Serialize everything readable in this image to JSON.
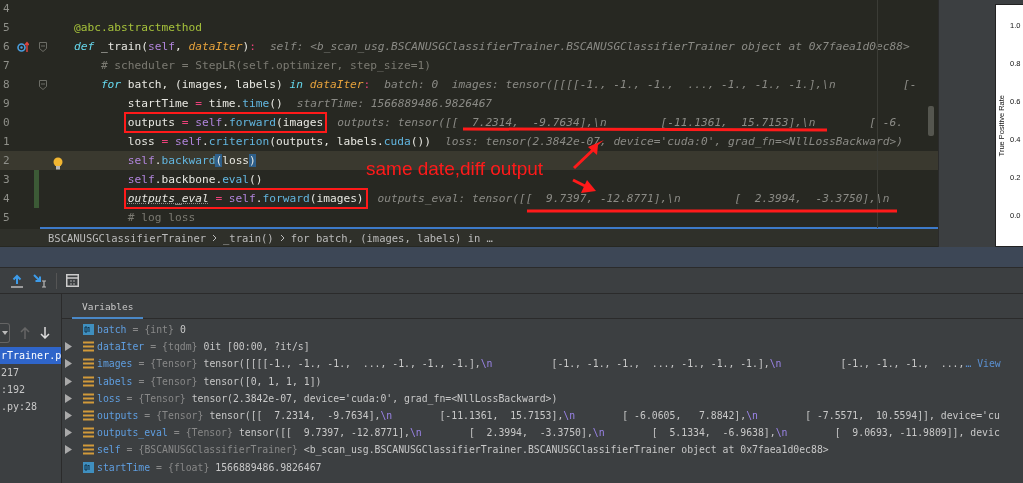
{
  "editor": {
    "lines": [
      {
        "number": "4"
      },
      {
        "number": "5",
        "tokens": [
          {
            "kind": "decorator",
            "text": "@abc.abstractmethod"
          }
        ]
      },
      {
        "number": "6",
        "overridden": true,
        "foldable": true,
        "tokens": [
          {
            "kind": "keyword",
            "text": "def"
          },
          {
            "kind": "plain",
            "text": " _train("
          },
          {
            "kind": "self",
            "text": "self"
          },
          {
            "kind": "plain",
            "text": ", "
          },
          {
            "kind": "param",
            "text": "dataIter"
          },
          {
            "kind": "plain",
            "text": ")"
          },
          {
            "kind": "op",
            "text": ":"
          }
        ],
        "hint": "self: <b_scan_usg.BSCANUSGClassifierTrainer.BSCANUSGClassifierTrainer object at 0x7faea1d0ec88>",
        "children": [
          {
            "number": "7",
            "tokens": [
              {
                "kind": "comment",
                "text": "# scheduler = StepLR(self.optimizer, step_size=1)"
              }
            ]
          },
          {
            "number": "8",
            "foldable": true,
            "tokens": [
              {
                "kind": "keyword",
                "text": "for"
              },
              {
                "kind": "plain",
                "text": " batch, (images, labels) "
              },
              {
                "kind": "keyword",
                "text": "in "
              },
              {
                "kind": "param",
                "text": "dataIter"
              },
              {
                "kind": "op",
                "text": ":"
              }
            ],
            "hint": "batch: 0  images: tensor([[[[-1., -1., -1.,  ..., -1., -1., -1.],\\n          [-",
            "children": [
              {
                "number": "9",
                "tokens": [
                  {
                    "kind": "plain",
                    "text": "startTime"
                  },
                  {
                    "kind": "op",
                    "text": " = "
                  },
                  {
                    "kind": "plain",
                    "text": "time."
                  },
                  {
                    "kind": "fn",
                    "text": "time"
                  },
                  {
                    "kind": "plain",
                    "text": "()"
                  }
                ],
                "hint": "startTime: 1566889486.9826467"
              },
              {
                "number": "0",
                "annotated": true,
                "tokens": [
                  {
                    "kind": "plain",
                    "text": "outputs"
                  },
                  {
                    "kind": "op",
                    "text": " = "
                  },
                  {
                    "kind": "self",
                    "text": "self"
                  },
                  {
                    "kind": "plain",
                    "text": "."
                  },
                  {
                    "kind": "fn",
                    "text": "forward"
                  },
                  {
                    "kind": "plain",
                    "text": "(images"
                  }
                ],
                "hint": "outputs: tensor([[  7.2314,  -9.7634],\\n        [-11.1361,  15.7153],\\n        [ -6."
              },
              {
                "number": "1",
                "tokens": [
                  {
                    "kind": "plain",
                    "text": "loss"
                  },
                  {
                    "kind": "op",
                    "text": " = "
                  },
                  {
                    "kind": "self",
                    "text": "self"
                  },
                  {
                    "kind": "plain",
                    "text": "."
                  },
                  {
                    "kind": "fn",
                    "text": "criterion"
                  },
                  {
                    "kind": "plain",
                    "text": "(outputs, labels."
                  },
                  {
                    "kind": "fn",
                    "text": "cuda"
                  },
                  {
                    "kind": "plain",
                    "text": "())"
                  }
                ],
                "hint": "loss: tensor(2.3842e-07, device='cuda:0', grad_fn=<NllLossBackward>)"
              },
              {
                "number": "2",
                "current": true,
                "intention_bulb": true,
                "tokens": [
                  {
                    "kind": "self",
                    "text": "self"
                  },
                  {
                    "kind": "plain",
                    "text": "."
                  },
                  {
                    "kind": "fn",
                    "text": "backward"
                  },
                  {
                    "kind": "match",
                    "text": "("
                  },
                  {
                    "kind": "plain",
                    "text": "loss"
                  },
                  {
                    "kind": "match",
                    "text": ")"
                  }
                ]
              },
              {
                "number": "3",
                "changed": true,
                "tokens": [
                  {
                    "kind": "self",
                    "text": "self"
                  },
                  {
                    "kind": "plain",
                    "text": ".backbone."
                  },
                  {
                    "kind": "fn",
                    "text": "eval"
                  },
                  {
                    "kind": "plain",
                    "text": "()"
                  }
                ]
              },
              {
                "number": "4",
                "changed": true,
                "annotated": true,
                "tokens": [
                  {
                    "kind": "local",
                    "text": "outputs_eval"
                  },
                  {
                    "kind": "op",
                    "text": " = "
                  },
                  {
                    "kind": "self",
                    "text": "self"
                  },
                  {
                    "kind": "plain",
                    "text": "."
                  },
                  {
                    "kind": "fn",
                    "text": "forward"
                  },
                  {
                    "kind": "plain",
                    "text": "(images)"
                  }
                ],
                "hint": "outputs_eval: tensor([[  9.7397, -12.8771],\\n        [  2.3994,  -3.3750],\\n"
              },
              {
                "number": "5",
                "tokens": [
                  {
                    "kind": "comment",
                    "text": "# log loss"
                  }
                ]
              }
            ]
          }
        ]
      }
    ],
    "annotation": {
      "note": "same date,diff output"
    },
    "breadcrumbs": [
      "BSCANUSGClassifierTrainer",
      "_train()",
      "for batch, (images, labels) in …"
    ]
  },
  "plot": {
    "ylabel": "True Positive Rate",
    "yticks": [
      "1.0",
      "0.8",
      "0.6",
      "0.4",
      "0.2",
      "0.0"
    ]
  },
  "frames": {
    "items": [
      {
        "label": "rTrainer.p",
        "selected": true
      },
      {
        "label": "217",
        "selected": false
      },
      {
        "label": ":192",
        "selected": false
      },
      {
        "label": ".py:28",
        "selected": false
      }
    ]
  },
  "variables": {
    "tab": "Variables",
    "rows": [
      {
        "name": "batch",
        "sep": "=",
        "type": "{int}",
        "kind": "primitive",
        "expandable": false,
        "value": [
          {
            "kind": "text",
            "text": "0"
          }
        ]
      },
      {
        "name": "dataIter",
        "sep": "=",
        "type": "{tqdm}",
        "kind": "object",
        "expandable": true,
        "value": [
          {
            "kind": "text",
            "text": "0it [00:00, ?it/s]"
          }
        ]
      },
      {
        "name": "images",
        "sep": "=",
        "type": "{Tensor}",
        "kind": "object",
        "expandable": true,
        "value": [
          {
            "kind": "text",
            "text": "tensor([[[[-1., -1., -1.,  ..., -1., -1., -1.],"
          },
          {
            "kind": "escape",
            "text": "\\n"
          },
          {
            "kind": "text",
            "text": "          [-1., -1., -1.,  ..., -1., -1., -1.],"
          },
          {
            "kind": "escape",
            "text": "\\n"
          },
          {
            "kind": "text",
            "text": "          [-1., -1., -1.,  ...,"
          },
          {
            "kind": "link",
            "text": "… View"
          }
        ]
      },
      {
        "name": "labels",
        "sep": "=",
        "type": "{Tensor}",
        "kind": "object",
        "expandable": true,
        "value": [
          {
            "kind": "text",
            "text": "tensor([0, 1, 1, 1])"
          }
        ]
      },
      {
        "name": "loss",
        "sep": "=",
        "type": "{Tensor}",
        "kind": "object",
        "expandable": true,
        "value": [
          {
            "kind": "text",
            "text": "tensor(2.3842e-07, device='cuda:0', grad_fn=<NllLossBackward>)"
          }
        ]
      },
      {
        "name": "outputs",
        "sep": "=",
        "type": "{Tensor}",
        "kind": "object",
        "expandable": true,
        "value": [
          {
            "kind": "text",
            "text": "tensor([[  7.2314,  -9.7634],"
          },
          {
            "kind": "escape",
            "text": "\\n"
          },
          {
            "kind": "text",
            "text": "        [-11.1361,  15.7153],"
          },
          {
            "kind": "escape",
            "text": "\\n"
          },
          {
            "kind": "text",
            "text": "        [ -6.0605,   7.8842],"
          },
          {
            "kind": "escape",
            "text": "\\n"
          },
          {
            "kind": "text",
            "text": "        [ -7.5571,  10.5594]], device='cu"
          }
        ]
      },
      {
        "name": "outputs_eval",
        "sep": "=",
        "type": "{Tensor}",
        "kind": "object",
        "expandable": true,
        "value": [
          {
            "kind": "text",
            "text": "tensor([[  9.7397, -12.8771],"
          },
          {
            "kind": "escape",
            "text": "\\n"
          },
          {
            "kind": "text",
            "text": "        [  2.3994,  -3.3750],"
          },
          {
            "kind": "escape",
            "text": "\\n"
          },
          {
            "kind": "text",
            "text": "        [  5.1334,  -6.9638],"
          },
          {
            "kind": "escape",
            "text": "\\n"
          },
          {
            "kind": "text",
            "text": "        [  9.0693, -11.9809]], devic"
          }
        ]
      },
      {
        "name": "self",
        "sep": "=",
        "type": "{BSCANUSGClassifierTrainer}",
        "kind": "object",
        "expandable": true,
        "value": [
          {
            "kind": "text",
            "text": "<b_scan_usg.BSCANUSGClassifierTrainer.BSCANUSGClassifierTrainer object at 0x7faea1d0ec88>"
          }
        ]
      },
      {
        "name": "startTime",
        "sep": "=",
        "type": "{float}",
        "kind": "primitive",
        "expandable": false,
        "value": [
          {
            "kind": "text",
            "text": "1566889486.9826467"
          }
        ]
      }
    ]
  }
}
